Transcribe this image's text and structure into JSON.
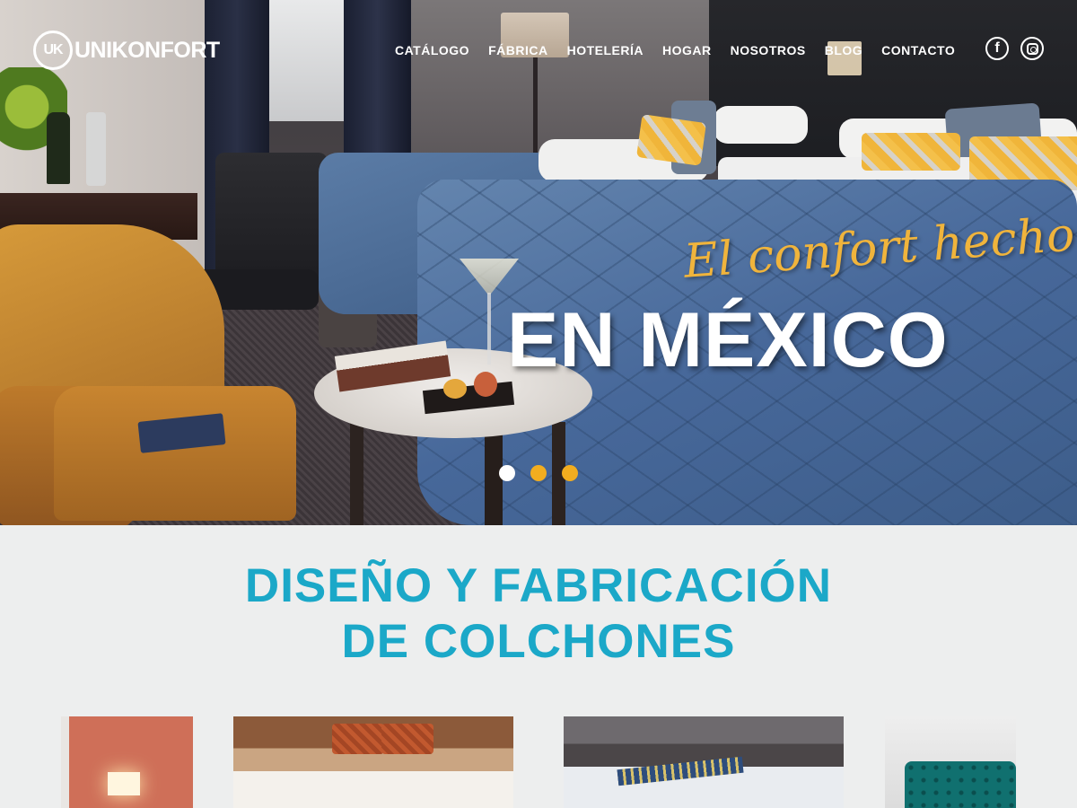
{
  "brand": {
    "logo_mark": "UK",
    "logo_text": "UNIKONFORT"
  },
  "nav": {
    "items": [
      {
        "label": "CATÁLOGO"
      },
      {
        "label": "FÁBRICA"
      },
      {
        "label": "HOTELERÍA"
      },
      {
        "label": "HOGAR"
      },
      {
        "label": "NOSOTROS"
      },
      {
        "label": "BLOG"
      },
      {
        "label": "CONTACTO"
      }
    ]
  },
  "social": {
    "facebook_glyph": "f",
    "icons": [
      "facebook-icon",
      "instagram-icon"
    ]
  },
  "hero": {
    "tagline": "El confort hecho",
    "headline": "EN MÉXICO",
    "slides_total": 3,
    "active_slide": 1
  },
  "section": {
    "title_line1": "DISEÑO Y FABRICACIÓN",
    "title_line2": "DE COLCHONES"
  },
  "colors": {
    "accent_cyan": "#1ba8c8",
    "tagline_gold": "#f0b43c",
    "dot_inactive": "#f2ad1f",
    "background": "#edeeee"
  }
}
